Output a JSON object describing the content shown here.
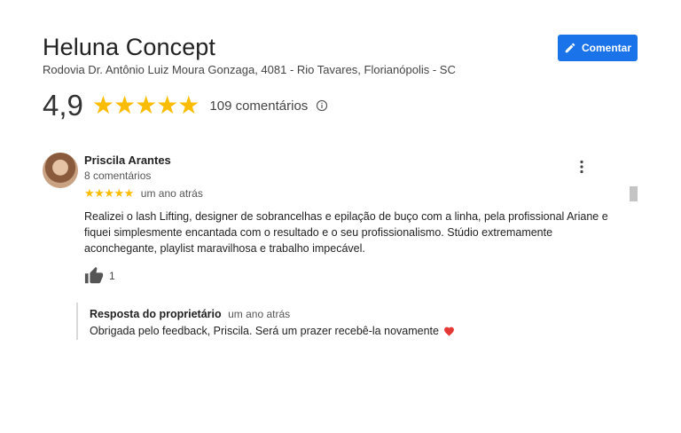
{
  "place": {
    "title": "Heluna Concept",
    "address": "Rodovia Dr. Antônio Luiz Moura Gonzaga, 4081 - Rio Tavares, Florianópolis - SC",
    "rating": "4,9",
    "rating_stars": 5,
    "review_count": "109 comentários"
  },
  "actions": {
    "comment_label": "Comentar",
    "comment_icon": "pencil-icon"
  },
  "review": {
    "reviewer_name": "Priscila Arantes",
    "reviewer_reviews": "8 comentários",
    "stars": 5,
    "time": "um ano atrás",
    "text": "Realizei o lash Lifting, designer de sobrancelhas e epilação de buço com a linha,  pela profissional Ariane e fiquei simplesmente encantada com o resultado e o seu profissionalismo. Stúdio extremamente aconchegante, playlist maravilhosa e trabalho impecável.",
    "likes": "1"
  },
  "owner_reply": {
    "label": "Resposta do proprietário",
    "time": "um ano atrás",
    "text": "Obrigada pelo feedback, Priscila. Será um prazer recebê-la novamente"
  },
  "colors": {
    "accent": "#1a73e8",
    "star": "#fbbc04",
    "heart": "#e53935"
  }
}
